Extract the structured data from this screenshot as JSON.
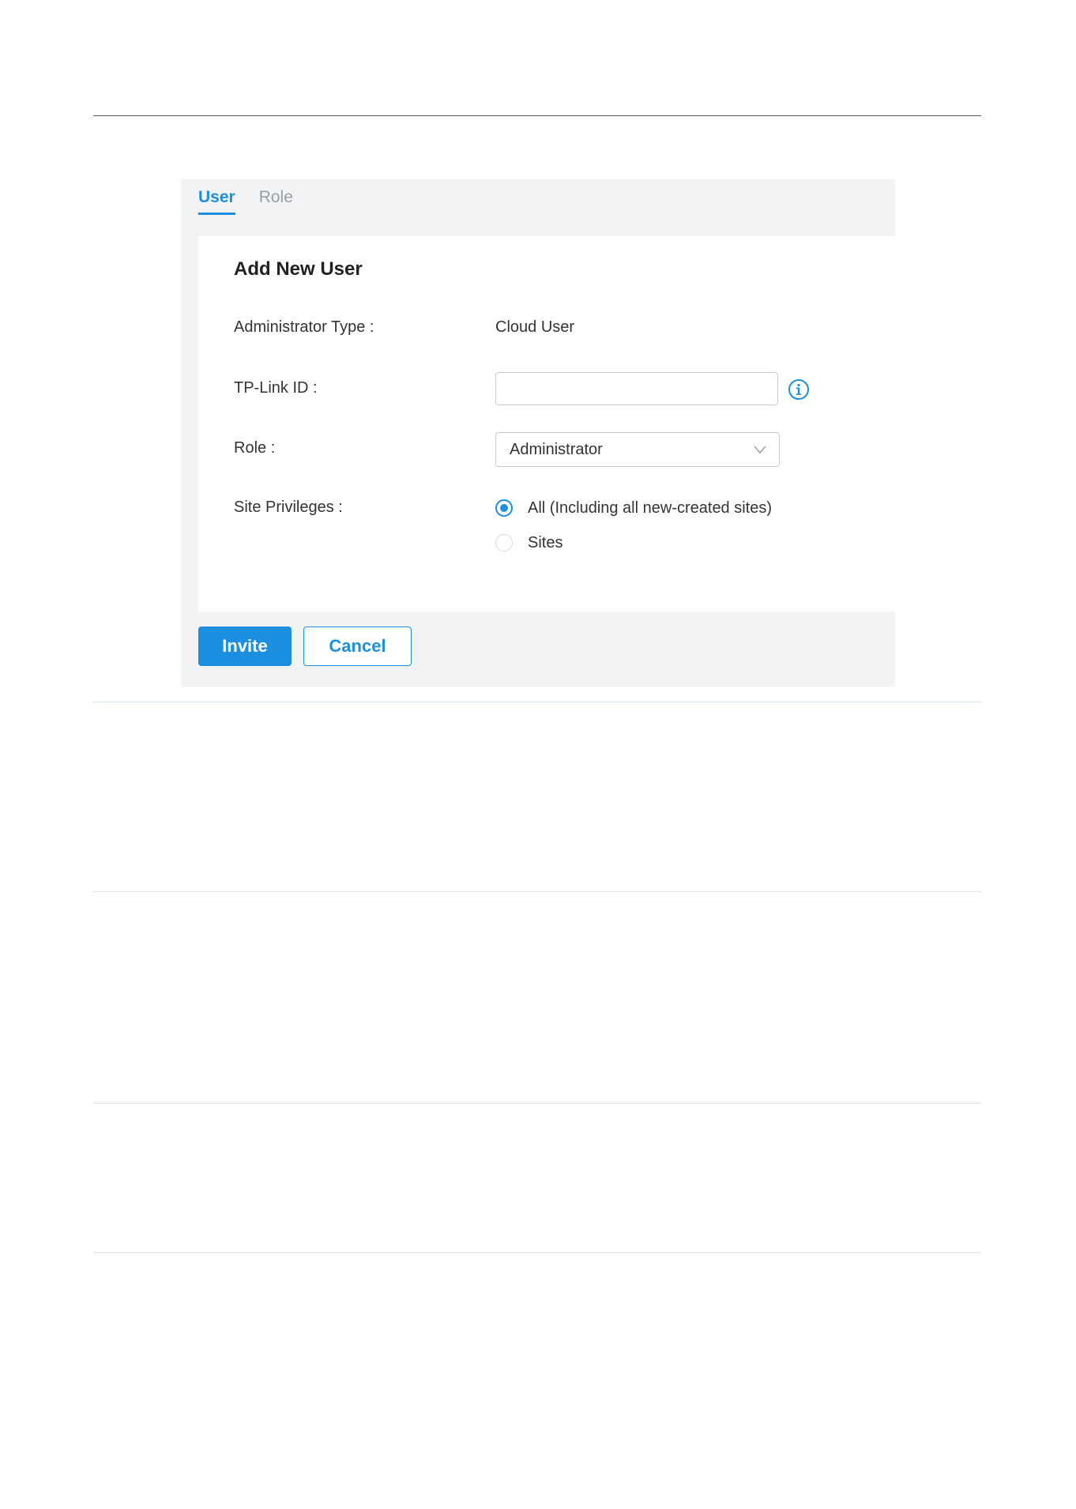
{
  "tabs": [
    {
      "label": "User",
      "active": true
    },
    {
      "label": "Role",
      "active": false
    }
  ],
  "form": {
    "title": "Add New User",
    "administrator_type": {
      "label": "Administrator Type :",
      "value": "Cloud User"
    },
    "tplink_id": {
      "label": "TP-Link ID :",
      "value": "",
      "placeholder": "",
      "help_icon": "info-icon"
    },
    "role": {
      "label": "Role :",
      "selected": "Administrator",
      "icon": "chevron-down-icon"
    },
    "site_privileges": {
      "label": "Site Privileges :",
      "options": [
        {
          "label": "All (Including all new-created sites)",
          "checked": true
        },
        {
          "label": "Sites",
          "checked": false
        }
      ]
    }
  },
  "buttons": {
    "invite": "Invite",
    "cancel": "Cancel"
  },
  "colors": {
    "accent": "#1c8fe0",
    "panel_bg": "#f2f3f5",
    "inactive_tab": "#9a9ea4"
  }
}
